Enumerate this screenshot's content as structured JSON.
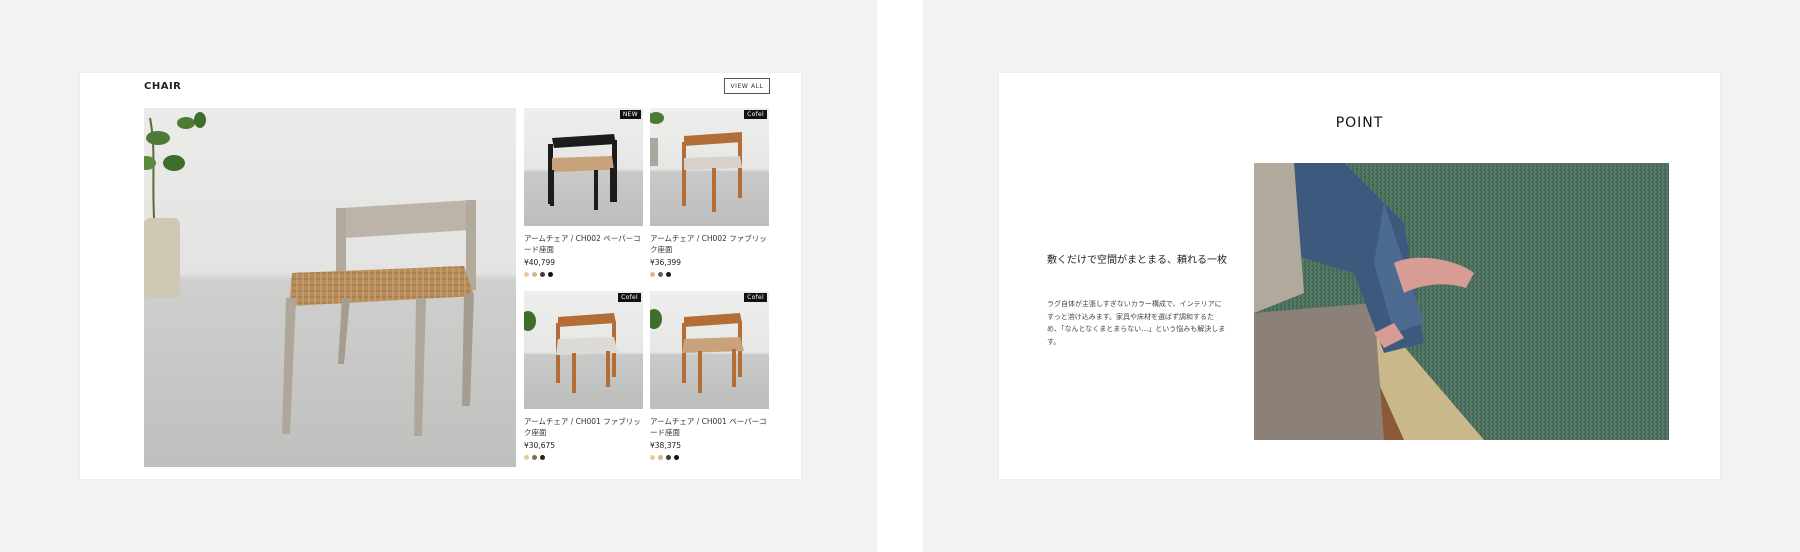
{
  "left": {
    "category_title": "CHAIR",
    "view_all_label": "VIEW ALL",
    "products": [
      {
        "name": "アームチェア / CH002 ペーパーコード座面",
        "price": "¥40,799",
        "badge": "NEW",
        "swatches": [
          "#e4c9a2",
          "#d9b68b",
          "#3b3b3b",
          "#111111"
        ]
      },
      {
        "name": "アームチェア / CH002 ファブリック座面",
        "price": "¥36,399",
        "badge": "Cofel",
        "swatches": [
          "#d9b68b",
          "#6b5a4d",
          "#1a1a1a"
        ]
      },
      {
        "name": "アームチェア / CH001 ファブリック座面",
        "price": "¥30,675",
        "badge": "Cofel",
        "swatches": [
          "#e4c9a2",
          "#8a6a4a",
          "#222222"
        ]
      },
      {
        "name": "アームチェア / CH001 ペーパーコード座面",
        "price": "¥38,375",
        "badge": "Cofel",
        "swatches": [
          "#e4c9a2",
          "#d9b68b",
          "#3b3b3b",
          "#111111"
        ]
      }
    ]
  },
  "right": {
    "point_title": "POINT",
    "heading": "敷くだけで空間がまとまる、頼れる一枚",
    "body": "ラグ自体が主張しすぎないカラー構成で、インテリアにすっと溶け込みます。家具や床材を選ばず調和するため、「なんとなくまとまらない…」という悩みも解決します。"
  }
}
